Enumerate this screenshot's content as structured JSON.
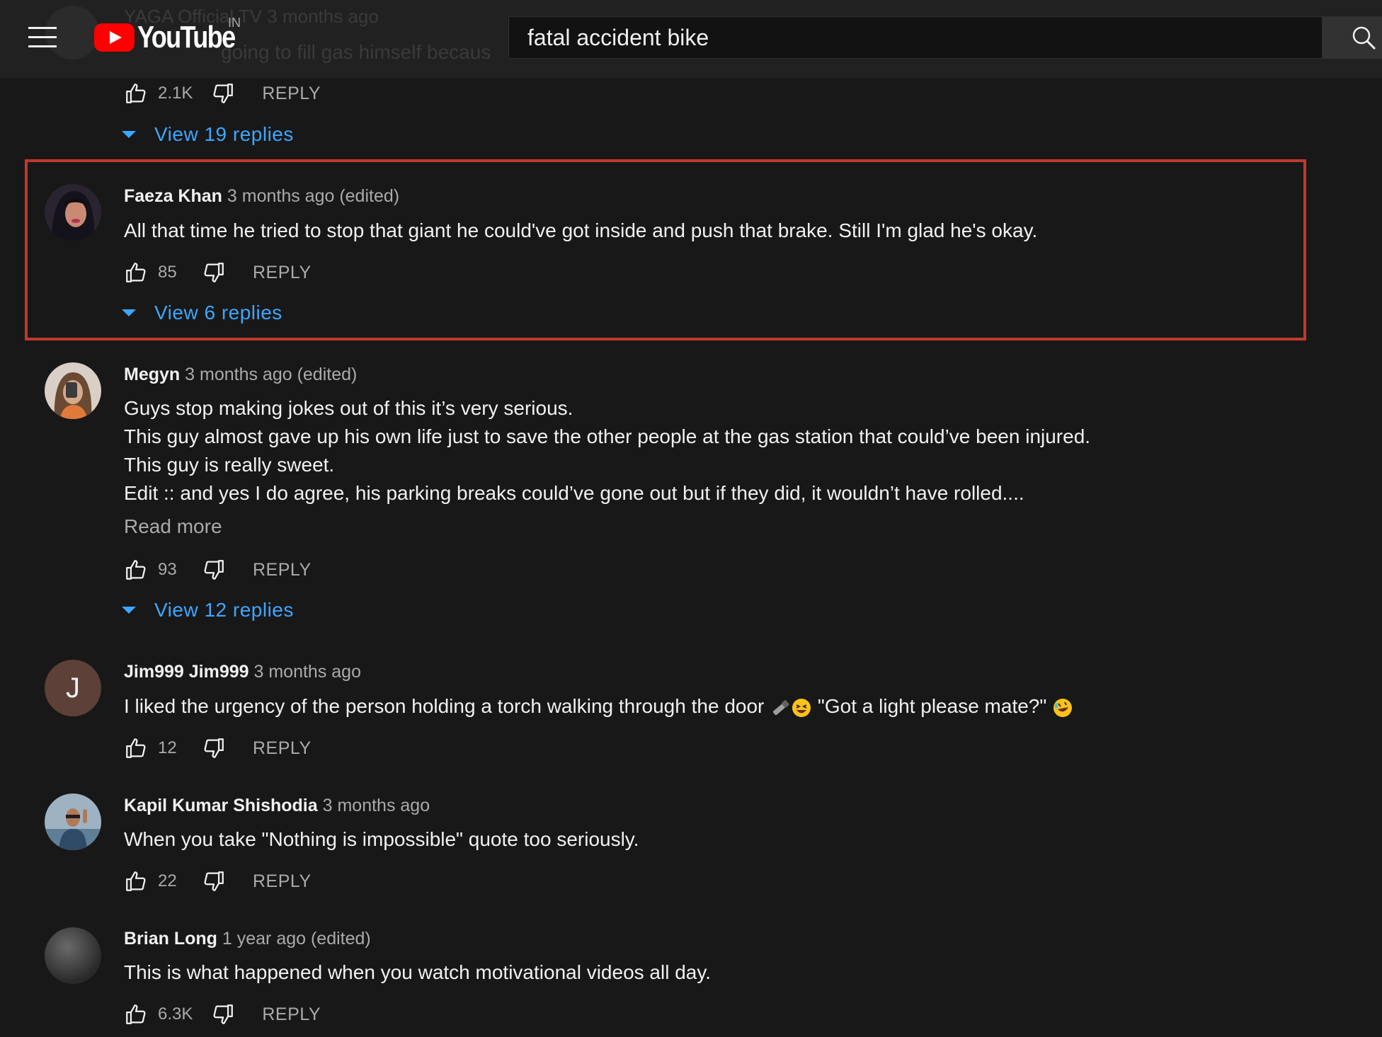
{
  "header": {
    "brand": "YouTube",
    "region": "IN",
    "search_value": "fatal accident bike",
    "behind_author": "YAGA Official TV 3 months ago",
    "behind_text": "going to fill gas himself becaus"
  },
  "comments": [
    {
      "likes": "2.1K",
      "reply_label": "REPLY",
      "view_replies": "View 19 replies"
    },
    {
      "author": "Faeza Khan",
      "meta": "3 months ago (edited)",
      "text": "All that time he tried to stop that giant he could've got inside and push that brake. Still I'm glad he's okay.",
      "likes": "85",
      "reply_label": "REPLY",
      "view_replies": "View 6 replies"
    },
    {
      "author": "Megyn",
      "meta": "3 months ago (edited)",
      "text": "Guys stop making jokes out of this it’s very serious.\nThis guy almost gave up his own life just to save the other people at the gas station that could’ve been injured.\nThis guy is really sweet.\nEdit :: and yes I do agree, his parking breaks could’ve gone out but if they did, it wouldn’t have rolled....",
      "read_more": "Read more",
      "likes": "93",
      "reply_label": "REPLY",
      "view_replies": "View 12 replies"
    },
    {
      "author": "Jim999 Jim999",
      "meta": "3 months ago",
      "avatar_letter": "J",
      "text_a": "I liked the urgency of the person holding a torch walking through the door",
      "text_b": "\"Got a light please mate?\"",
      "likes": "12",
      "reply_label": "REPLY"
    },
    {
      "author": "Kapil Kumar Shishodia",
      "meta": "3 months ago",
      "text": "When you take \"Nothing is impossible\" quote too seriously.",
      "likes": "22",
      "reply_label": "REPLY"
    },
    {
      "author": "Brian Long",
      "meta": "1 year ago (edited)",
      "text": "This is what happened when you watch motivational videos all day.",
      "likes": "6.3K",
      "reply_label": "REPLY"
    }
  ],
  "colors": {
    "background": "#181818",
    "link_blue": "#3ea6ff",
    "highlight_red": "#c0392b",
    "brand_red": "#ff0000"
  }
}
